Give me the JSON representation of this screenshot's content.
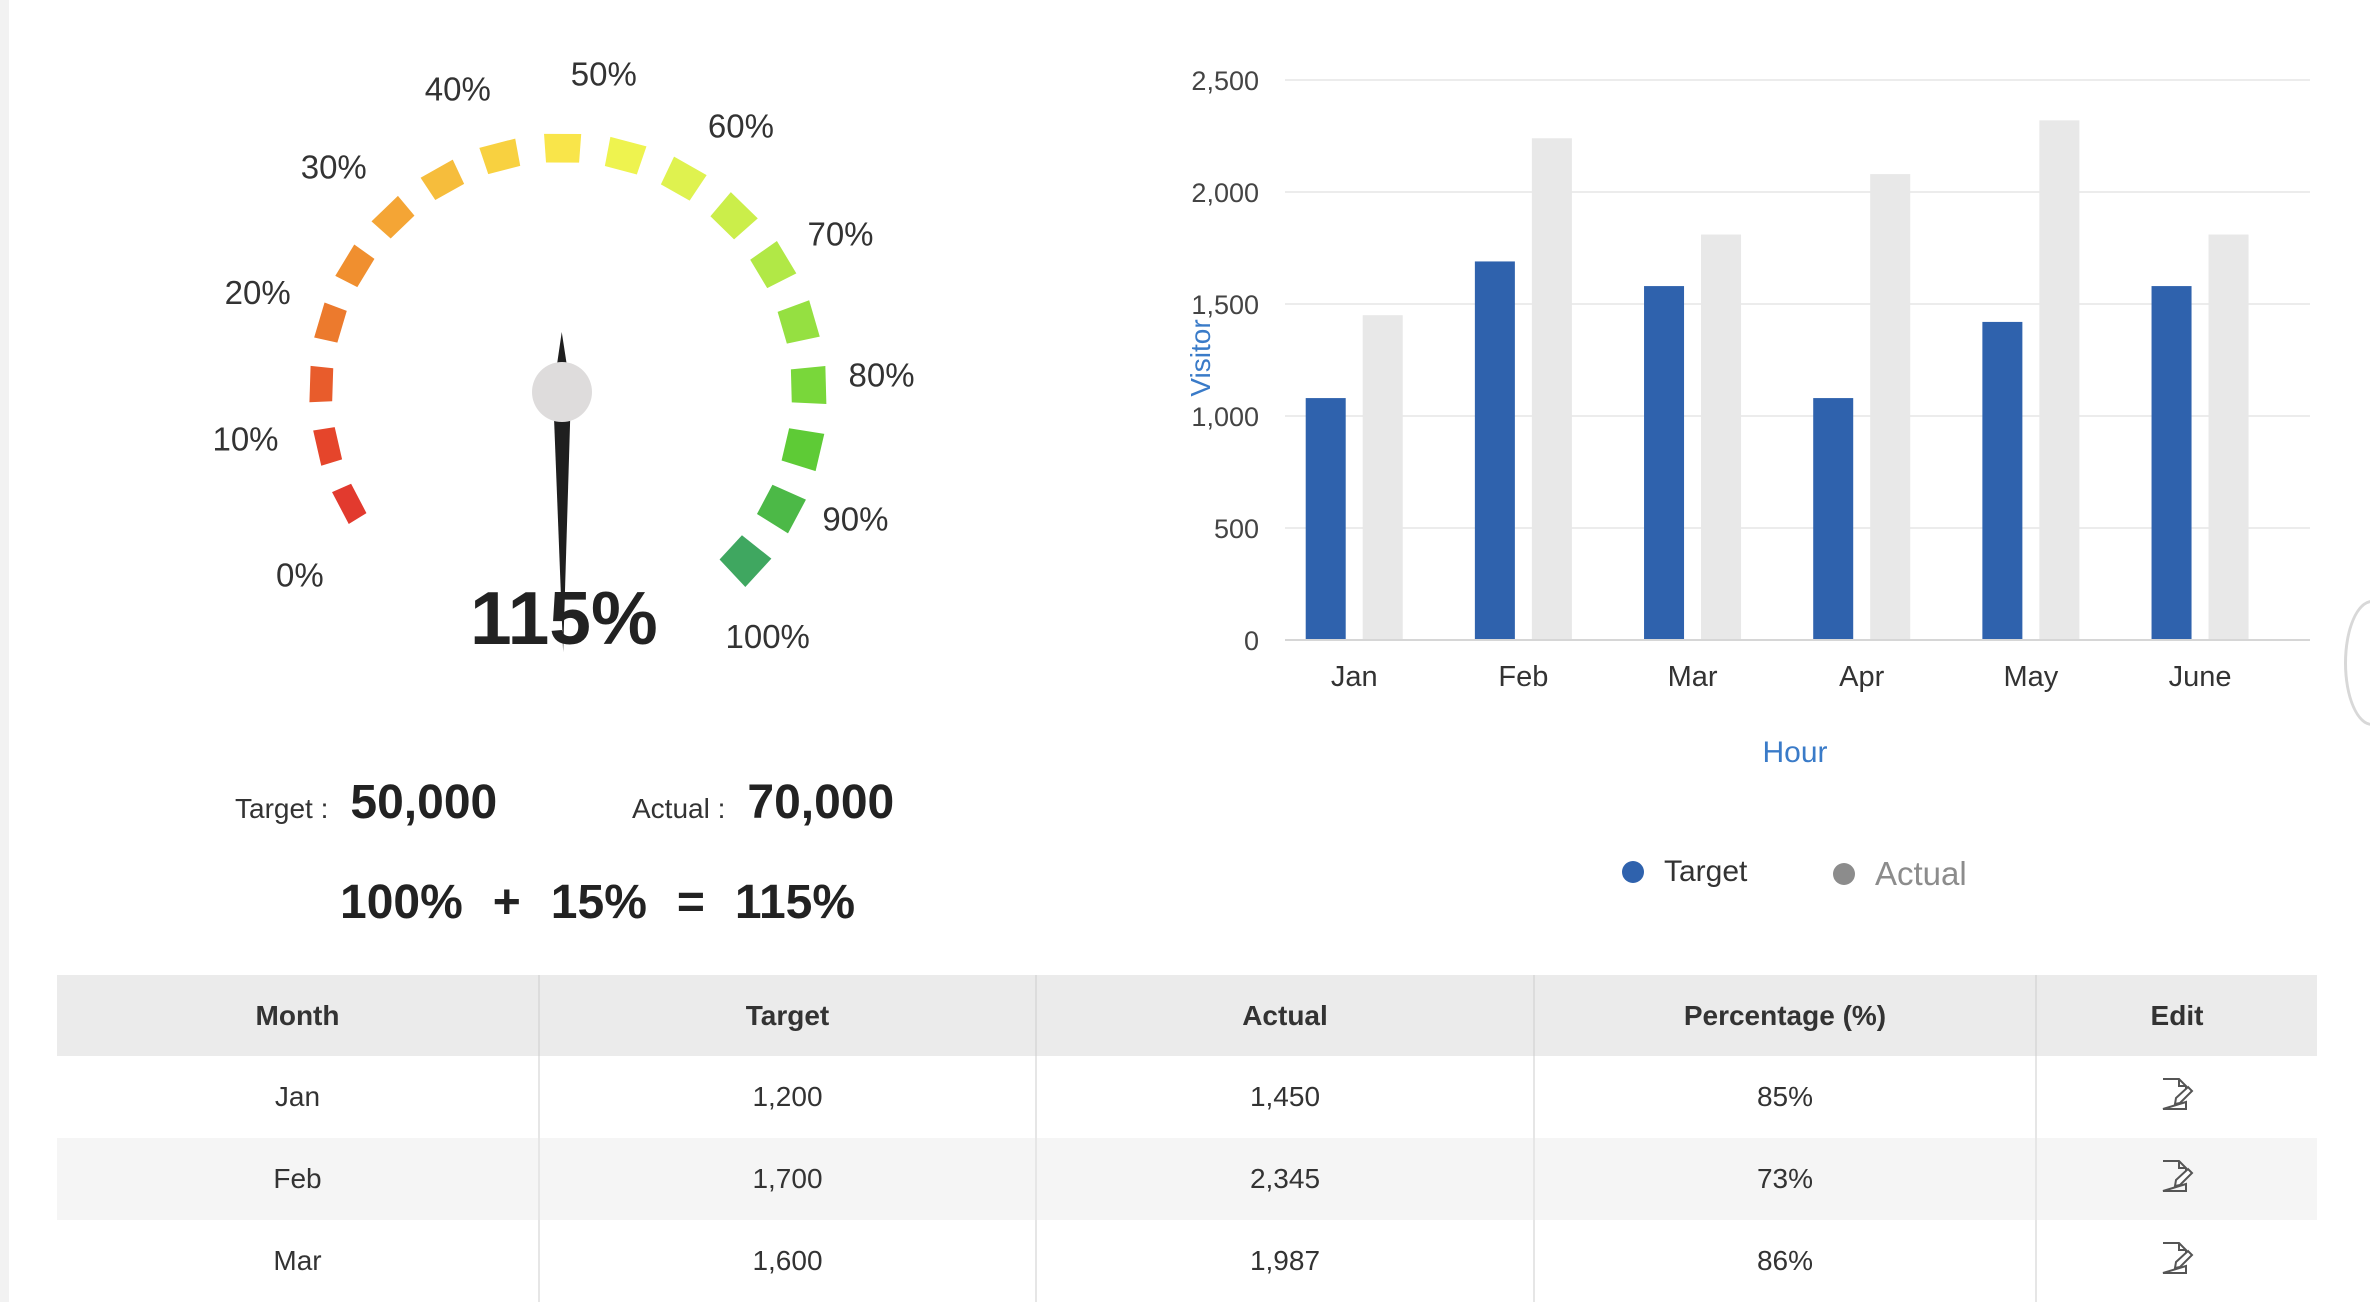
{
  "gauge": {
    "value_label": "115%",
    "value": 115,
    "scale_labels": [
      "0%",
      "10%",
      "20%",
      "30%",
      "40%",
      "50%",
      "60%",
      "70%",
      "80%",
      "90%",
      "100%"
    ],
    "target_label": "Target :",
    "target_value": "50,000",
    "actual_label": "Actual :",
    "actual_value": "70,000",
    "equation": [
      "100%",
      "+",
      "15%",
      "=",
      "115%"
    ],
    "segment_colors": [
      "#e23a2e",
      "#e5452b",
      "#e85c2c",
      "#ec7a2d",
      "#f08f2f",
      "#f4a535",
      "#f6bd3c",
      "#f8d140",
      "#f9e54a",
      "#eef34f",
      "#dff24f",
      "#cbee4a",
      "#b1e846",
      "#95e041",
      "#79d73a",
      "#5ecb36",
      "#4cb947",
      "#3fa760"
    ]
  },
  "chart_data": {
    "type": "bar",
    "categories": [
      "Jan",
      "Feb",
      "Mar",
      "Apr",
      "May",
      "June"
    ],
    "series": [
      {
        "name": "Target",
        "color": "#2f62ad",
        "values": [
          1080,
          1690,
          1580,
          1080,
          1420,
          1580
        ]
      },
      {
        "name": "Actual",
        "color": "#e8e8e8",
        "values": [
          1450,
          2240,
          1810,
          2080,
          2320,
          1810
        ]
      }
    ],
    "xlabel": "Hour",
    "ylabel": "Visitor",
    "ylim": [
      0,
      2500
    ],
    "yticks": [
      "0",
      "500",
      "1,000",
      "1,500",
      "2,000",
      "2,500"
    ],
    "grid": true,
    "legend": "bottom-center"
  },
  "legend": {
    "target_label": "Target",
    "actual_label": "Actual",
    "target_color": "#2f62ad",
    "actual_color": "#8c8c8c"
  },
  "table": {
    "headers": [
      "Month",
      "Target",
      "Actual",
      "Percentage (%)",
      "Edit"
    ],
    "rows": [
      [
        "Jan",
        "1,200",
        "1,450",
        "85%"
      ],
      [
        "Feb",
        "1,700",
        "2,345",
        "73%"
      ],
      [
        "Mar",
        "1,600",
        "1,987",
        "86%"
      ]
    ],
    "edit_icon": "edit-icon"
  }
}
